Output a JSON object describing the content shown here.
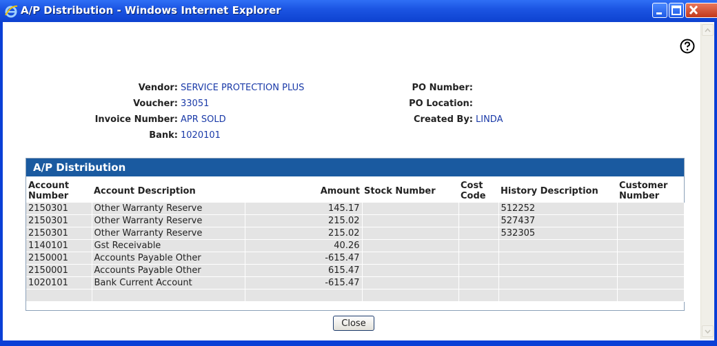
{
  "window": {
    "title": "A/P Distribution - Windows Internet Explorer"
  },
  "header": {
    "vendor_label": "Vendor:",
    "vendor_value": "SERVICE PROTECTION PLUS",
    "voucher_label": "Voucher:",
    "voucher_value": "33051",
    "invoice_label": "Invoice Number:",
    "invoice_value": "APR SOLD",
    "bank_label": "Bank:",
    "bank_value": "1020101",
    "po_number_label": "PO Number:",
    "po_number_value": "",
    "po_location_label": "PO Location:",
    "po_location_value": "",
    "created_by_label": "Created By:",
    "created_by_value": "LINDA"
  },
  "panel": {
    "title": "A/P Distribution"
  },
  "table": {
    "columns": {
      "account_number": "Account Number",
      "account_description": "Account Description",
      "amount": "Amount",
      "stock_number": "Stock Number",
      "cost_code": "Cost Code",
      "history_description": "History Description",
      "customer_number": "Customer Number"
    },
    "rows": [
      {
        "account": "2150301",
        "description": "Other Warranty Reserve",
        "amount": "145.17",
        "stock": "",
        "cost": "",
        "history": "512252",
        "customer": ""
      },
      {
        "account": "2150301",
        "description": "Other Warranty Reserve",
        "amount": "215.02",
        "stock": "",
        "cost": "",
        "history": "527437",
        "customer": ""
      },
      {
        "account": "2150301",
        "description": "Other Warranty Reserve",
        "amount": "215.02",
        "stock": "",
        "cost": "",
        "history": "532305",
        "customer": ""
      },
      {
        "account": "1140101",
        "description": "Gst Receivable",
        "amount": "40.26",
        "stock": "",
        "cost": "",
        "history": "",
        "customer": ""
      },
      {
        "account": "2150001",
        "description": "Accounts Payable Other",
        "amount": "-615.47",
        "stock": "",
        "cost": "",
        "history": "",
        "customer": ""
      },
      {
        "account": "2150001",
        "description": "Accounts Payable Other",
        "amount": "615.47",
        "stock": "",
        "cost": "",
        "history": "",
        "customer": ""
      },
      {
        "account": "1020101",
        "description": "Bank Current Account",
        "amount": "-615.47",
        "stock": "",
        "cost": "",
        "history": "",
        "customer": ""
      },
      {
        "account": "",
        "description": "",
        "amount": "",
        "stock": "",
        "cost": "",
        "history": "",
        "customer": ""
      }
    ]
  },
  "buttons": {
    "close": "Close"
  },
  "icons": {
    "title": "internet-explorer-icon",
    "help": "help-icon",
    "minimize": "minimize-icon",
    "maximize": "maximize-icon",
    "close": "close-icon"
  }
}
